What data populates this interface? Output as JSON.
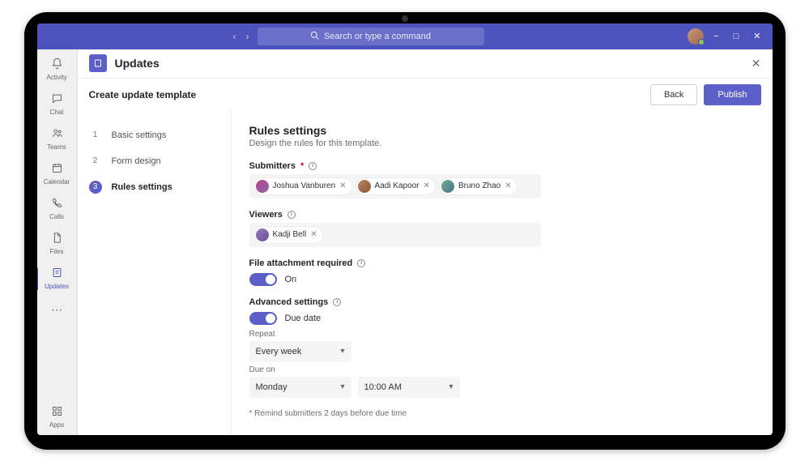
{
  "titlebar": {
    "search_placeholder": "Search or type a command"
  },
  "apprail": {
    "items": [
      {
        "label": "Activity"
      },
      {
        "label": "Chat"
      },
      {
        "label": "Teams"
      },
      {
        "label": "Calendar"
      },
      {
        "label": "Calls"
      },
      {
        "label": "Files"
      },
      {
        "label": "Updates"
      }
    ],
    "footer_label": "Apps"
  },
  "app": {
    "title": "Updates"
  },
  "subheader": {
    "title": "Create update template",
    "back_label": "Back",
    "publish_label": "Publish"
  },
  "steps": [
    {
      "num": "1",
      "label": "Basic settings"
    },
    {
      "num": "2",
      "label": "Form design"
    },
    {
      "num": "3",
      "label": "Rules settings"
    }
  ],
  "panel": {
    "heading": "Rules settings",
    "subtitle": "Design the rules for this template.",
    "submitters_label": "Submitters",
    "viewers_label": "Viewers",
    "submitters": [
      {
        "name": "Joshua Vanburen"
      },
      {
        "name": "Aadi Kapoor"
      },
      {
        "name": "Bruno Zhao"
      }
    ],
    "viewers": [
      {
        "name": "Kadji Bell"
      }
    ],
    "file_attachment": {
      "label": "File attachment required",
      "state_label": "On"
    },
    "advanced": {
      "label": "Advanced settings",
      "duedate_label": "Due date",
      "repeat_label": "Repeat",
      "repeat_value": "Every week",
      "dueon_label": "Due on",
      "dueon_day": "Monday",
      "dueon_time": "10:00 AM"
    },
    "footnote": "* Remind submitters 2 days before due time"
  }
}
